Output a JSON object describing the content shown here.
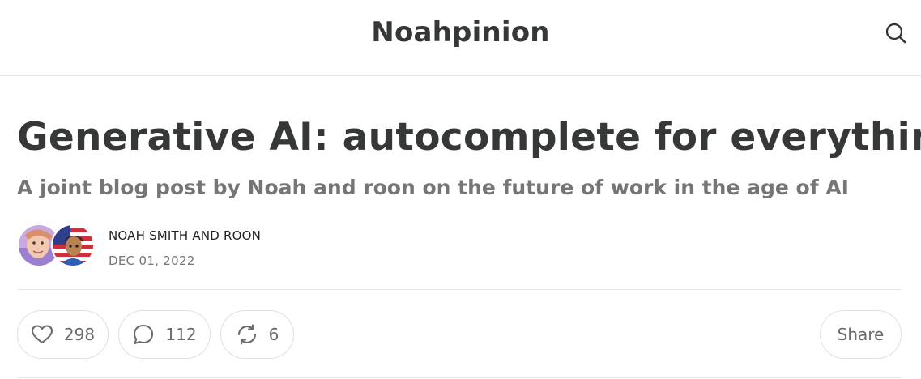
{
  "header": {
    "site_title": "Noahpinion"
  },
  "post": {
    "title": "Generative AI: autocomplete for everything",
    "subtitle": "A joint blog post by Noah and roon on the future of work in the age of AI",
    "authors": "NOAH SMITH AND ROON",
    "date": "DEC 01, 2022"
  },
  "actions": {
    "likes": "298",
    "comments": "112",
    "restacks": "6",
    "share_label": "Share"
  },
  "icons": {
    "search": "search-icon",
    "like": "heart-icon",
    "comment": "comment-icon",
    "restack": "restack-icon"
  },
  "colors": {
    "title": "#363737",
    "muted": "#757575",
    "border": "#e6e6e6"
  }
}
